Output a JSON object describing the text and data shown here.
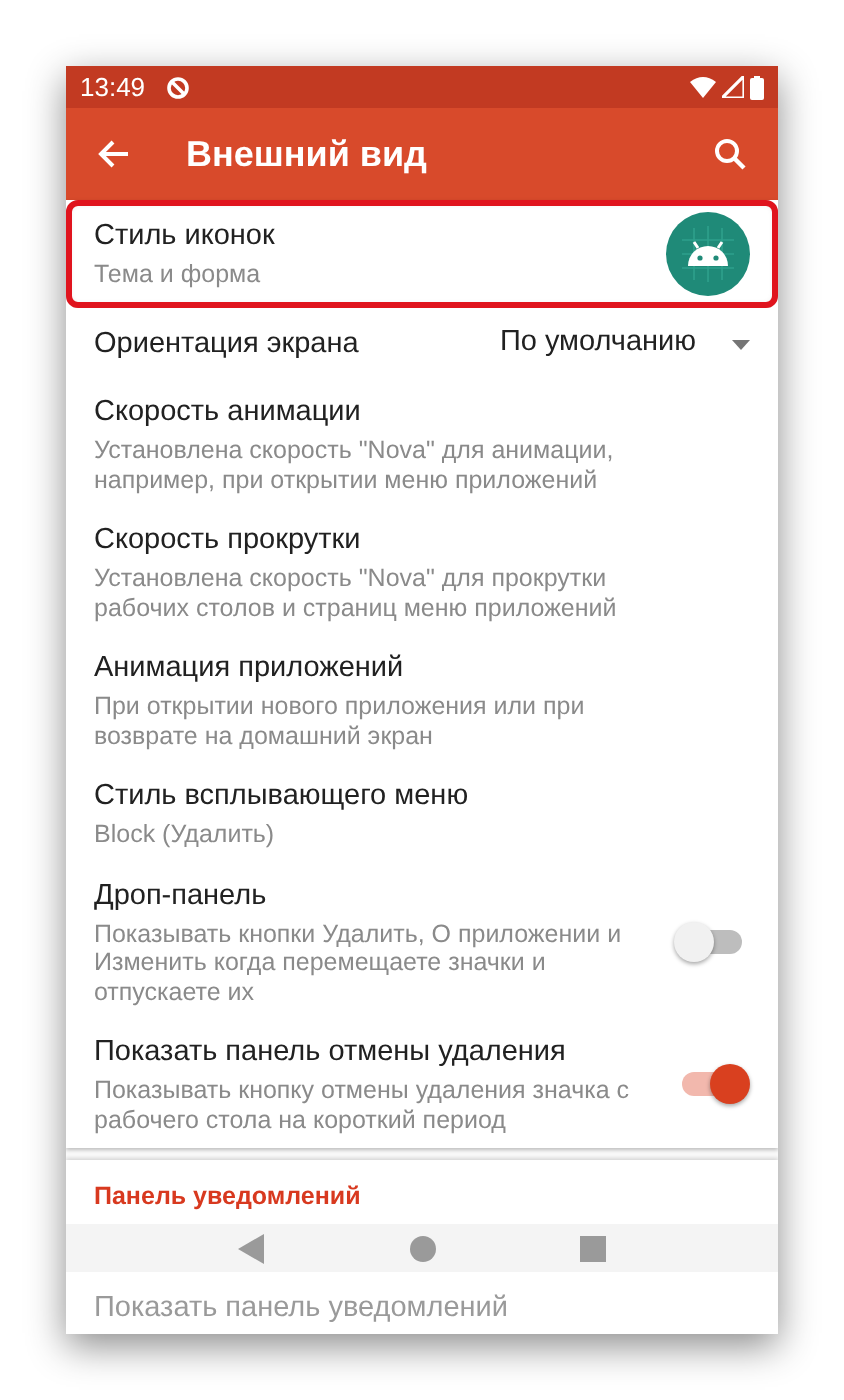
{
  "status_bar": {
    "time": "13:49"
  },
  "app_bar": {
    "title": "Внешний вид"
  },
  "sections": [
    {
      "items": [
        {
          "kind": "icon",
          "title": "Стиль иконок",
          "subtitle": "Тема и форма",
          "highlighted": true
        },
        {
          "kind": "dropdown",
          "title": "Ориентация экрана",
          "value": "По умолчанию",
          "highlighted": false
        },
        {
          "kind": "text",
          "title": "Скорость анимации",
          "subtitle": "Установлена скорость \"Nova\" для анимации, например, при открытии меню приложений",
          "highlighted": false
        },
        {
          "kind": "text",
          "title": "Скорость прокрутки",
          "subtitle": "Установлена скорость \"Nova\" для прокрутки рабочих столов и страниц меню приложений",
          "highlighted": false
        },
        {
          "kind": "text",
          "title": "Анимация приложений",
          "subtitle": "При открытии нового приложения или при возврате на домашний экран",
          "highlighted": false
        },
        {
          "kind": "text",
          "title": "Стиль всплывающего меню",
          "subtitle": "Block (Удалить)",
          "highlighted": false
        },
        {
          "kind": "switch",
          "title": "Дроп-панель",
          "subtitle": "Показывать кнопки Удалить, О приложении и Изменить когда перемещаете значки и отпускаете их",
          "on": false,
          "highlighted": false
        },
        {
          "kind": "switch",
          "title": "Показать панель отмены удаления",
          "subtitle": "Показывать кнопку отмены удаления значка с рабочего стола на короткий период",
          "on": true,
          "highlighted": false
        }
      ]
    },
    {
      "header": "Панель уведомлений",
      "items": [
        {
          "kind": "text",
          "title": "Показать панель уведомлений",
          "highlighted": false
        }
      ]
    }
  ]
}
